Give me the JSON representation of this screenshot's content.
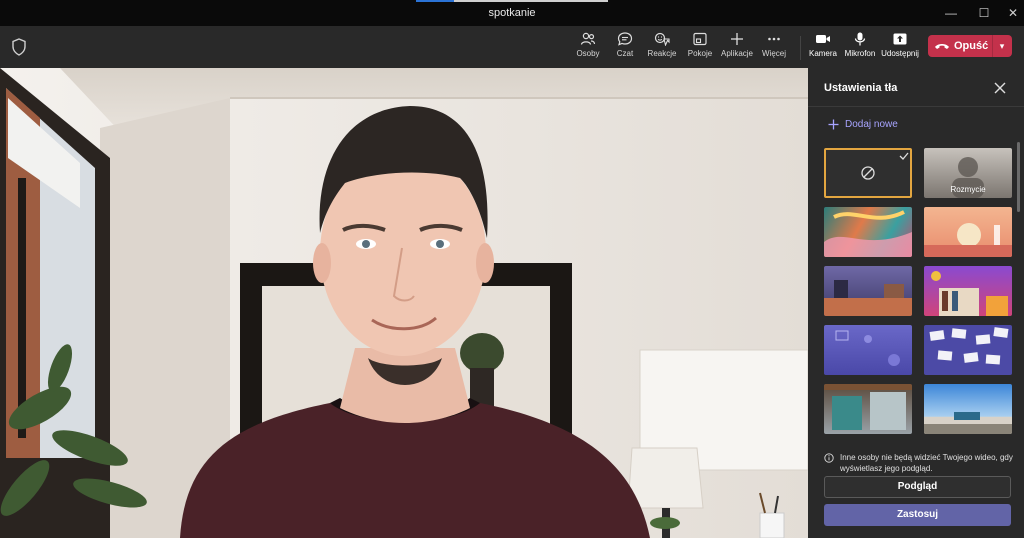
{
  "window": {
    "title": "spotkanie",
    "minimize": "—",
    "maximize": "☐",
    "close": "✕"
  },
  "toolbar": {
    "items": [
      {
        "label": "Osoby",
        "icon": "people-icon"
      },
      {
        "label": "Czat",
        "icon": "chat-icon"
      },
      {
        "label": "Reakcje",
        "icon": "reactions-icon"
      },
      {
        "label": "Pokoje",
        "icon": "rooms-icon"
      },
      {
        "label": "Aplikacje",
        "icon": "apps-icon"
      },
      {
        "label": "Więcej",
        "icon": "more-icon"
      },
      {
        "label": "Kamera",
        "icon": "camera-icon"
      },
      {
        "label": "Mikrofon",
        "icon": "microphone-icon"
      },
      {
        "label": "Udostępnij",
        "icon": "share-icon"
      }
    ],
    "leave_label": "Opuść",
    "leave_color": "#c4314b"
  },
  "panel": {
    "title": "Ustawienia tła",
    "add_new": "Dodaj nowe",
    "tiles": [
      {
        "name": "none",
        "caption": ""
      },
      {
        "name": "blur",
        "caption": "Rozmycie"
      },
      {
        "name": "background-1",
        "caption": ""
      },
      {
        "name": "background-2",
        "caption": ""
      },
      {
        "name": "background-3",
        "caption": ""
      },
      {
        "name": "background-4",
        "caption": ""
      },
      {
        "name": "background-5",
        "caption": ""
      },
      {
        "name": "background-6",
        "caption": ""
      },
      {
        "name": "background-7",
        "caption": ""
      },
      {
        "name": "background-8",
        "caption": ""
      }
    ],
    "info": "Inne osoby nie będą widzieć Twojego wideo, gdy wyświetlasz jego podgląd.",
    "preview_button": "Podgląd",
    "apply_button": "Zastosuj",
    "accent_color": "#6264a7",
    "selected_border": "#e3a640"
  }
}
